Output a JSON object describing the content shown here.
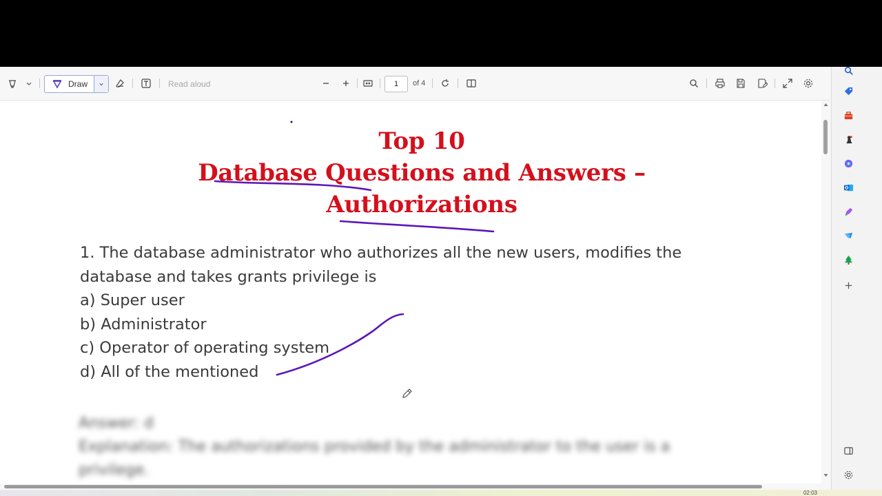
{
  "toolbar": {
    "draw_label": "Draw",
    "read_aloud_label": "Read aloud",
    "page_current": "1",
    "page_total": "of 4"
  },
  "document": {
    "title_line1": "Top 10",
    "title_line2": "Database Questions and Answers –",
    "title_line3": "Authorizations",
    "question_line1": "1. The database administrator who authorizes all the new users, modifies the",
    "question_line2": "database and takes grants privilege is",
    "options": [
      "a) Super user",
      "b) Administrator",
      "c) Operator of operating system",
      "d) All of the mentioned"
    ],
    "answer_line1": "Answer: d",
    "answer_line2": "Explanation: The authorizations provided by the administrator to the user is a",
    "answer_line3": "privilege."
  },
  "taskbar": {
    "clock": "02:03"
  },
  "colors": {
    "title_red": "#d4101c",
    "annotation_purple": "#5b16b8",
    "draw_accent": "#5b3fc4"
  },
  "icons": {
    "sidebar": [
      "search-icon",
      "tag-icon",
      "toolbox-icon",
      "chess-icon",
      "copilot-icon",
      "outlook-icon",
      "designer-icon",
      "send-icon",
      "tree-icon",
      "add-icon",
      "sidebar-panel-icon",
      "settings-icon"
    ]
  }
}
